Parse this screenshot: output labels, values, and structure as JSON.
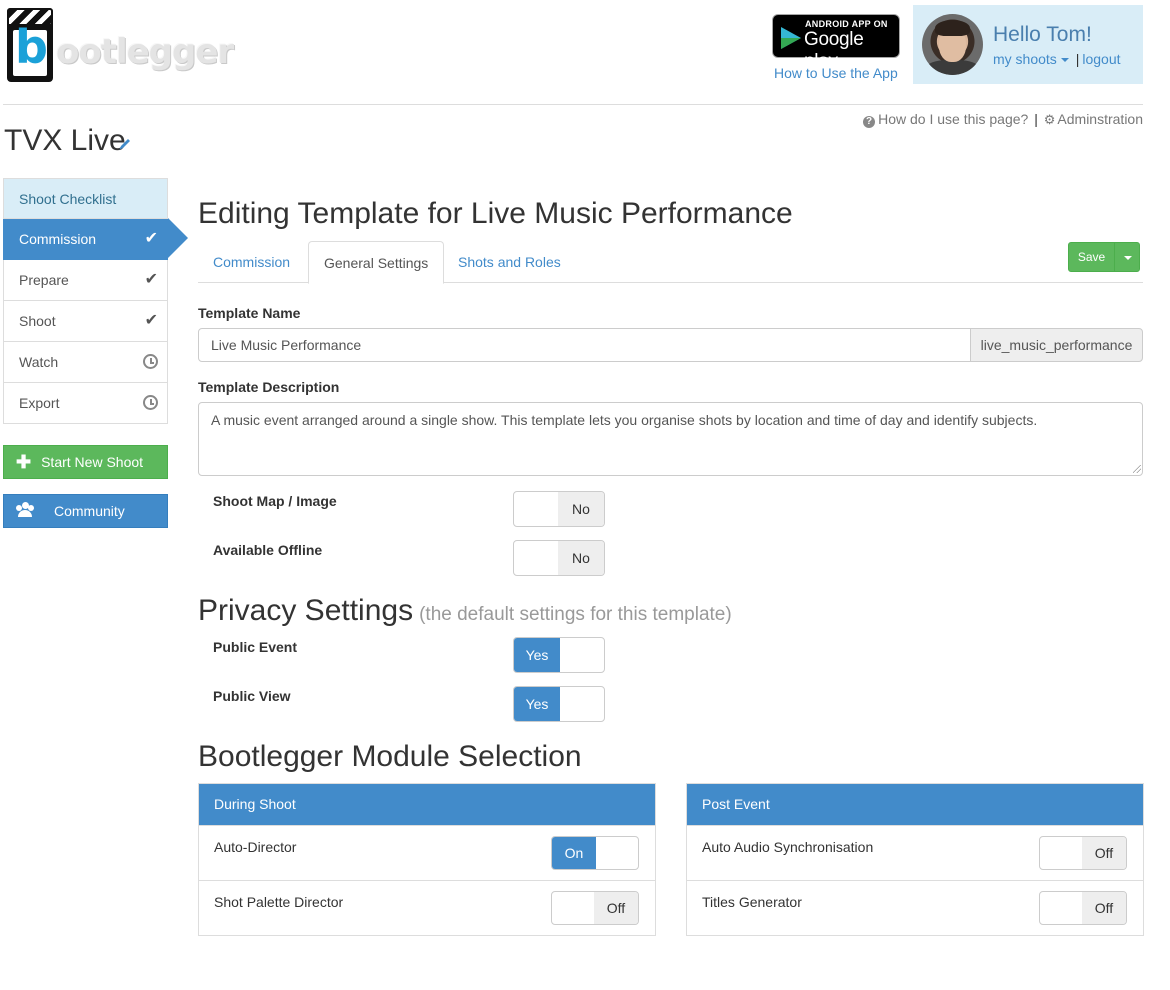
{
  "brand": {
    "logo_letter": "b",
    "logo_text": "ootlegger"
  },
  "google_play": {
    "small": "ANDROID APP ON",
    "big": "Google play"
  },
  "header": {
    "how_to": "How to Use the App",
    "greeting": "Hello Tom!",
    "my_shoots": "my shoots",
    "separator": "|",
    "logout": "logout"
  },
  "help": {
    "question": "How do I use this page?",
    "bar": "|",
    "admin": "Adminstration"
  },
  "page_title": "TVX Live",
  "sidebar": {
    "items": [
      {
        "label": "Shoot Checklist",
        "status": ""
      },
      {
        "label": "Commission",
        "status": "check"
      },
      {
        "label": "Prepare",
        "status": "check"
      },
      {
        "label": "Shoot",
        "status": "check"
      },
      {
        "label": "Watch",
        "status": "clock"
      },
      {
        "label": "Export",
        "status": "clock"
      }
    ],
    "check_glyph": "✔",
    "new_shoot": "Start New Shoot",
    "community": "Community"
  },
  "editor": {
    "title": "Editing Template for Live Music Performance",
    "tabs": [
      "Commission",
      "General Settings",
      "Shots and Roles"
    ],
    "active_tab": "General Settings",
    "save": "Save",
    "template_name_label": "Template Name",
    "template_name_value": "Live Music Performance",
    "template_slug": "live_music_performance",
    "description_label": "Template Description",
    "description_value": "A music event arranged around a single show. This template lets you organise shots by location and time of day and identify subjects.",
    "shoot_map_label": "Shoot Map / Image",
    "shoot_map_value": "No",
    "offline_label": "Available Offline",
    "offline_value": "No"
  },
  "privacy": {
    "title": "Privacy Settings",
    "subtitle": "(the default settings for this template)",
    "public_event_label": "Public Event",
    "public_event_value": "Yes",
    "public_view_label": "Public View",
    "public_view_value": "Yes"
  },
  "modules": {
    "title": "Bootlegger Module Selection",
    "during": {
      "heading": "During Shoot",
      "rows": [
        {
          "label": "Auto-Director",
          "value": "On"
        },
        {
          "label": "Shot Palette Director",
          "value": "Off"
        }
      ]
    },
    "post": {
      "heading": "Post Event",
      "rows": [
        {
          "label": "Auto Audio Synchronisation",
          "value": "Off"
        },
        {
          "label": "Titles Generator",
          "value": "Off"
        }
      ]
    }
  },
  "colors": {
    "primary": "#428bca",
    "success": "#5cb85c",
    "info_bg": "#d9edf7"
  }
}
